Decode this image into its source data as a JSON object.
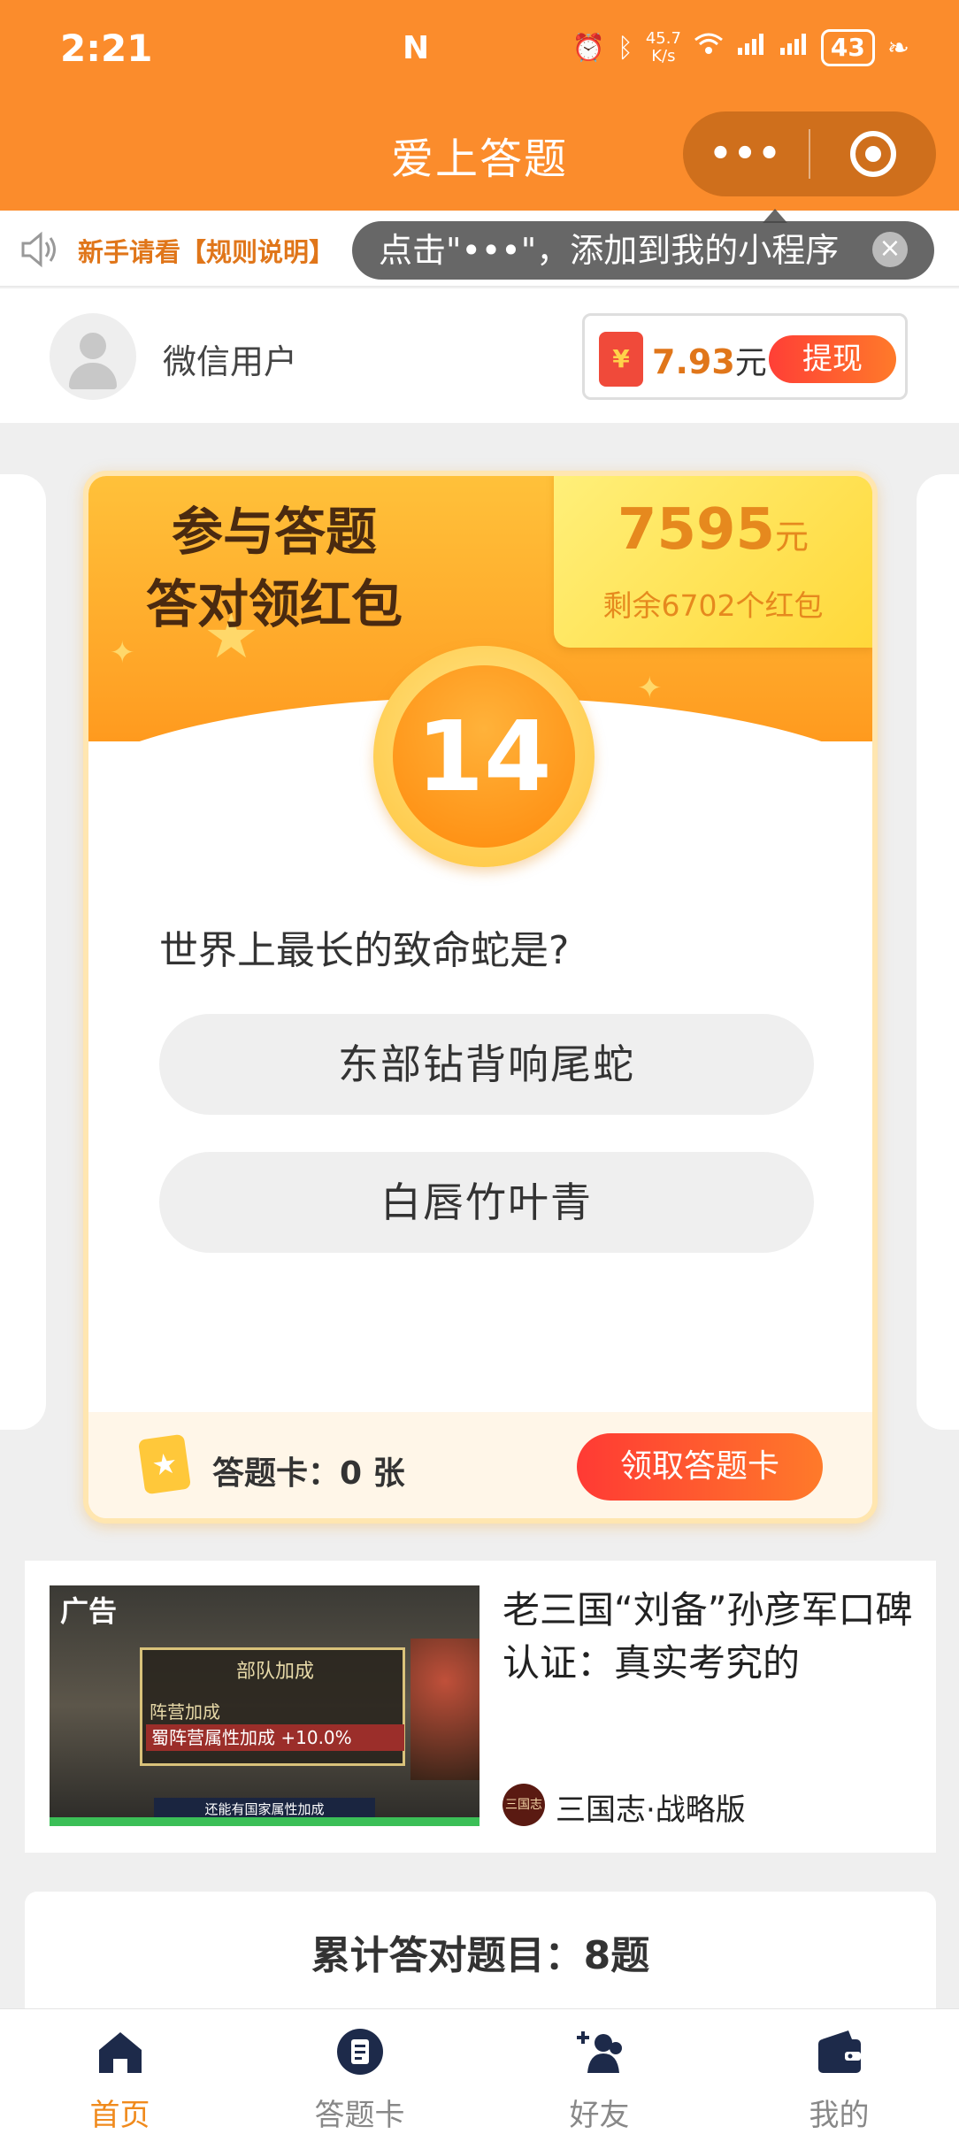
{
  "status_bar": {
    "time": "2:21",
    "network_speed": "45.7\nK/s",
    "battery": "43"
  },
  "header": {
    "title": "爱上答题"
  },
  "notice": {
    "text": "新手请看【规则说明】",
    "tooltip": "点击\"•••\"，添加到我的小程序"
  },
  "user": {
    "name": "微信用户",
    "balance": "7.93",
    "balance_unit": "元",
    "withdraw_label": "提现"
  },
  "quiz_card": {
    "hero_title_line1": "参与答题",
    "hero_title_line2": "答对领红包",
    "prize_amount": "7595",
    "prize_unit": "元",
    "prize_remaining": "剩余6702个红包",
    "timer": "14",
    "question": "世界上最长的致命蛇是?",
    "options": [
      "东部钻背响尾蛇",
      "白唇竹叶青"
    ],
    "card_count_label": "答题卡：0 张",
    "get_card_label": "领取答题卡"
  },
  "ad": {
    "badge": "广告",
    "panel_title": "部队加成",
    "panel_line1": "阵营加成",
    "panel_line2": "蜀阵营属性加成 +10.0%",
    "panel_bottom": "还能有国家属性加成",
    "headline": "老三国“刘备”孙彦军口碑认证：真实考究的",
    "source_logo": "三国志",
    "source": "三国志·战略版"
  },
  "summary": {
    "text": "累计答对题目：8题"
  },
  "tabbar": {
    "items": [
      {
        "label": "首页",
        "icon": "home-icon"
      },
      {
        "label": "答题卡",
        "icon": "answer-card-icon"
      },
      {
        "label": "好友",
        "icon": "friends-icon"
      },
      {
        "label": "我的",
        "icon": "wallet-icon"
      }
    ],
    "active_color": "#f08a1c"
  },
  "colors": {
    "brand_orange": "#fb8c2c",
    "accent_red": "#ff3f36"
  }
}
